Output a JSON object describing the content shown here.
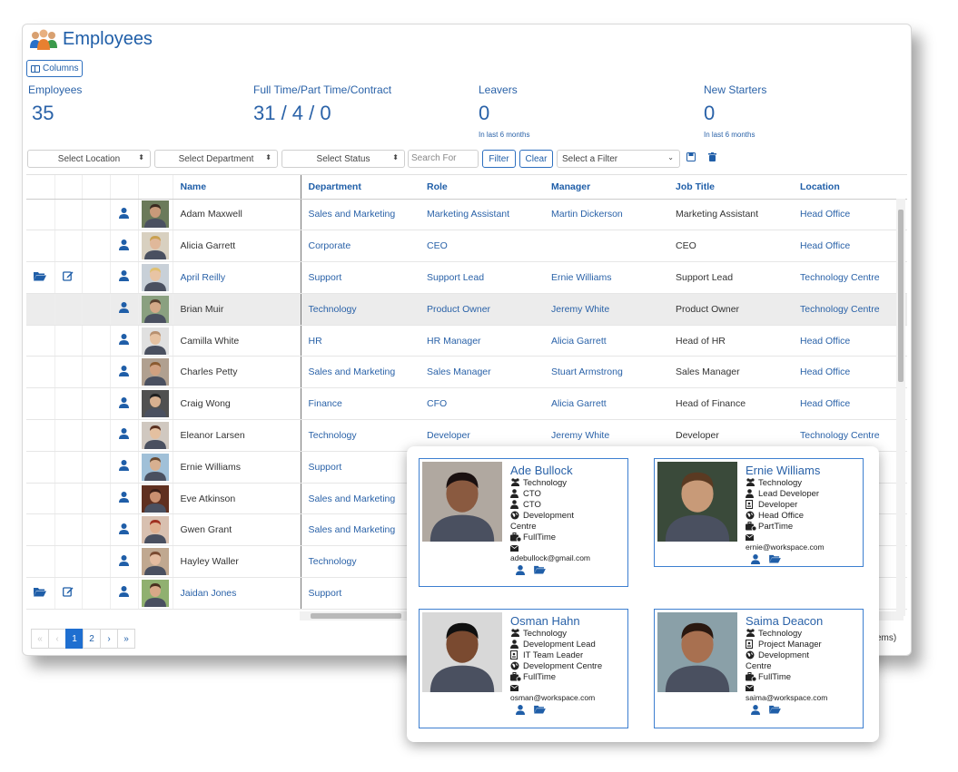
{
  "header": {
    "title": "Employees",
    "columns_label": "Columns"
  },
  "stats": [
    {
      "label": "Employees",
      "value": "35",
      "sub": ""
    },
    {
      "label": "Full Time/Part Time/Contract",
      "value": "31 / 4 / 0",
      "sub": ""
    },
    {
      "label": "Leavers",
      "value": "0",
      "sub": "In last 6 months"
    },
    {
      "label": "New Starters",
      "value": "0",
      "sub": "In last 6 months"
    }
  ],
  "filters": {
    "location": "Select Location",
    "department": "Select Department",
    "status": "Select Status",
    "search_placeholder": "Search For",
    "filter_btn": "Filter",
    "clear_btn": "Clear",
    "saved_filter": "Select a Filter"
  },
  "table": {
    "headers": [
      "Name",
      "Department",
      "Role",
      "Manager",
      "Job Title",
      "Location"
    ],
    "rows": [
      {
        "name": "Adam Maxwell",
        "dept": "Sales and Marketing",
        "role": "Marketing Assistant",
        "manager": "Martin Dickerson",
        "job": "Marketing Assistant",
        "loc": "Head Office",
        "actions": false,
        "name_link": false,
        "skin": "#c89a7a",
        "hair": "#3a2a20",
        "bg": "#6b7a5a"
      },
      {
        "name": "Alicia Garrett",
        "dept": "Corporate",
        "role": "CEO",
        "manager": "",
        "job": "CEO",
        "loc": "Head Office",
        "actions": false,
        "name_link": false,
        "skin": "#e0b89a",
        "hair": "#c9a050",
        "bg": "#d8d0c0"
      },
      {
        "name": "April Reilly",
        "dept": "Support",
        "role": "Support Lead",
        "manager": "Ernie Williams",
        "job": "Support Lead",
        "loc": "Technology Centre",
        "actions": true,
        "name_link": true,
        "skin": "#e8c4a4",
        "hair": "#e0c070",
        "bg": "#c8d0d8"
      },
      {
        "name": "Brian Muir",
        "dept": "Technology",
        "role": "Product Owner",
        "manager": "Jeremy White",
        "job": "Product Owner",
        "loc": "Technology Centre",
        "actions": false,
        "name_link": false,
        "skin": "#d4a888",
        "hair": "#5a4030",
        "bg": "#8aa080"
      },
      {
        "name": "Camilla White",
        "dept": "HR",
        "role": "HR Manager",
        "manager": "Alicia Garrett",
        "job": "Head of HR",
        "loc": "Head Office",
        "actions": false,
        "name_link": false,
        "skin": "#e6c2a2",
        "hair": "#b89070",
        "bg": "#e0e0e0"
      },
      {
        "name": "Charles Petty",
        "dept": "Sales and Marketing",
        "role": "Sales Manager",
        "manager": "Stuart Armstrong",
        "job": "Sales Manager",
        "loc": "Head Office",
        "actions": false,
        "name_link": false,
        "skin": "#d0a080",
        "hair": "#8a5a30",
        "bg": "#b0a090"
      },
      {
        "name": "Craig Wong",
        "dept": "Finance",
        "role": "CFO",
        "manager": "Alicia Garrett",
        "job": "Head of Finance",
        "loc": "Head Office",
        "actions": false,
        "name_link": false,
        "skin": "#d8b090",
        "hair": "#202020",
        "bg": "#505050"
      },
      {
        "name": "Eleanor Larsen",
        "dept": "Technology",
        "role": "Developer",
        "manager": "Jeremy White",
        "job": "Developer",
        "loc": "Technology Centre",
        "actions": false,
        "name_link": false,
        "skin": "#e4c0a0",
        "hair": "#5a3020",
        "bg": "#d0c8c0"
      },
      {
        "name": "Ernie Williams",
        "dept": "Support",
        "role": "",
        "manager": "",
        "job": "",
        "loc": "",
        "actions": false,
        "name_link": false,
        "skin": "#d8b090",
        "hair": "#6a4a30",
        "bg": "#a0c0d8"
      },
      {
        "name": "Eve Atkinson",
        "dept": "Sales and Marketing",
        "role": "",
        "manager": "",
        "job": "",
        "loc": "",
        "actions": false,
        "name_link": false,
        "skin": "#c89070",
        "hair": "#3a2018",
        "bg": "#603020"
      },
      {
        "name": "Gwen Grant",
        "dept": "Sales and Marketing",
        "role": "",
        "manager": "",
        "job": "",
        "loc": "",
        "actions": false,
        "name_link": false,
        "skin": "#e0b090",
        "hair": "#a03020",
        "bg": "#d8c0b0"
      },
      {
        "name": "Hayley Waller",
        "dept": "Technology",
        "role": "",
        "manager": "",
        "job": "",
        "loc": "",
        "actions": false,
        "name_link": false,
        "skin": "#e4bca0",
        "hair": "#7a4a30",
        "bg": "#c0a890"
      },
      {
        "name": "Jaidan Jones",
        "dept": "Support",
        "role": "",
        "manager": "",
        "job": "",
        "loc": "",
        "actions": true,
        "name_link": true,
        "skin": "#d8a888",
        "hair": "#4a3020",
        "bg": "#90b070"
      }
    ]
  },
  "pager": {
    "first": "«",
    "prev": "‹",
    "p1": "1",
    "p2": "2",
    "next": "›",
    "last": "»",
    "items_text": "ems)"
  },
  "cards": [
    {
      "name": "Ade Bullock",
      "lines": [
        "Technology",
        "CTO",
        "CTO",
        "Development"
      ],
      "tail": "Centre",
      "type": "FullTime",
      "email": "adebullock@gmail.com",
      "skin": "#8a5a40",
      "hair": "#1a1010",
      "bg": "#b0a8a0"
    },
    {
      "name": "Ernie Williams",
      "lines": [
        "Technology",
        "Lead Developer",
        "Developer",
        "Head Office",
        "PartTime"
      ],
      "tail": "",
      "type": "",
      "email": "ernie@workspace.com",
      "skin": "#c89a78",
      "hair": "#5a3a22",
      "bg": "#3a4a3a"
    },
    {
      "name": "Osman Hahn",
      "lines": [
        "Technology",
        "Development Lead",
        "IT Team Leader",
        "Development Centre",
        "FullTime"
      ],
      "tail": "",
      "type": "",
      "email": "osman@workspace.com",
      "skin": "#7a4a30",
      "hair": "#101010",
      "bg": "#d8d8d8"
    },
    {
      "name": "Saima Deacon",
      "lines": [
        "Technology",
        "Project Manager",
        "Development"
      ],
      "tail": "Centre",
      "type": "FullTime",
      "email": "saima@workspace.com",
      "skin": "#a87050",
      "hair": "#2a1810",
      "bg": "#8aa0a8"
    }
  ]
}
